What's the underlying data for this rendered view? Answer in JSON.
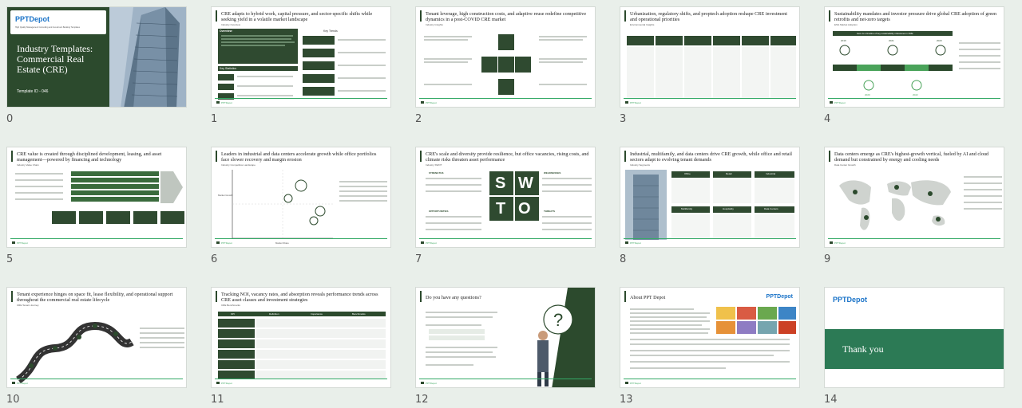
{
  "slides": [
    {
      "index": "0",
      "title": "Industry Templates: Commercial Real Estate (CRE)",
      "subtitle": "Template ID - 046",
      "brand": "PPTDepot",
      "tagline": "High Quality Management Consulting and Investment Banking Templates"
    },
    {
      "index": "1",
      "title": "CRE adapts to hybrid work, capital pressure, and sector-specific shifts while seeking yield in a volatile market landscape",
      "sub": "Industry Overview",
      "h1": "Overview",
      "h2": "Key Statistics",
      "h3": "Key Trends",
      "rows": [
        "Market Size",
        "Growth Rate",
        "Vacancy Rate"
      ],
      "trends": [
        "Hybrid Work Impact",
        "Sustainability Push",
        "Data Center Boom",
        "Retail Resilience",
        "Capital Selectivity"
      ]
    },
    {
      "index": "2",
      "title": "Tenant leverage, high construction costs, and adaptive reuse redefine competitive dynamics in a post-COVID CRE market",
      "sub": "Industry Insights",
      "center": "Industry Rivalry",
      "forces": [
        "Threat of New Entrants",
        "Bargaining Power of Buyers",
        "Bargaining Power of Suppliers",
        "Threat of Substitutes"
      ]
    },
    {
      "index": "3",
      "title": "Urbanization, regulatory shifts, and proptech adoption reshape CRE investment and operational priorities",
      "sub": "Environmental Insights",
      "cols": [
        "Political",
        "Economic",
        "Social",
        "Technological",
        "Legal",
        "Environmental"
      ]
    },
    {
      "index": "4",
      "title": "Sustainability mandates and investor pressure drive global CRE adoption of green retrofits and net-zero targets",
      "sub": "ESG Market Adoption",
      "banner": "Here is a timeline of key sustainability milestones in CRE:",
      "years": [
        "2019",
        "2021",
        "2023",
        "2025",
        "2020",
        "2022",
        "2024"
      ]
    },
    {
      "index": "5",
      "title": "CRE value is created through disciplined development, leasing, and asset management—powered by financing and technology",
      "sub": "Industry Value Chain",
      "bars": [
        "Market Research",
        "Technology Integration",
        "Financing & Legal",
        "Construction Management",
        "Sustainability Consulting"
      ],
      "stages": [
        "Property Development",
        "Acquisition & Investment",
        "Leasing & Sales",
        "Property Management",
        "Disposition / Exit"
      ]
    },
    {
      "index": "6",
      "title": "Leaders in industrial and data centers accelerate growth while office portfolios face slower recovery and margin erosion",
      "sub": "Industry Competitive Landscape",
      "ylabel": "Market Growth",
      "xlabel": "Market Share"
    },
    {
      "index": "7",
      "title": "CRE's scale and diversity provide resilience, but office vacancies, rising costs, and climate risks threaten asset performance",
      "sub": "Industry SWOT",
      "letters": [
        "S",
        "W",
        "T",
        "O"
      ],
      "heads": [
        "STRENGTHS",
        "WEAKNESSES",
        "OPPORTUNITIES",
        "THREATS"
      ]
    },
    {
      "index": "8",
      "title": "Industrial, multifamily, and data centers drive CRE growth, while office and retail sectors adapt to evolving tenant demands",
      "sub": "Industry Segments",
      "segments": [
        "Office",
        "Retail",
        "Industrial",
        "Multifamily",
        "Hospitality",
        "Data Centers"
      ]
    },
    {
      "index": "9",
      "title": "Data centers emerge as CRE's highest-growth vertical, fueled by AI and cloud demand but constrained by energy and cooling needs",
      "sub": "Data Center Growth"
    },
    {
      "index": "10",
      "title": "Tenant experience hinges on space fit, lease flexibility, and operational support throughout the commercial real estate lifecycle",
      "sub": "CRE Tenant Journey",
      "steps": [
        "Need Identification",
        "Property Search",
        "Negotiation & Leasing",
        "Move-In & Setup",
        "Occupancy Management",
        "Exit or Renewal"
      ]
    },
    {
      "index": "11",
      "title": "Tracking NOI, vacancy rates, and absorption reveals performance trends across CRE asset classes and investment strategies",
      "sub": "CRE Benchmarks",
      "heads": [
        "KPI",
        "Definition",
        "Importance",
        "Benchmarks"
      ],
      "kpis": [
        "Net Operating Income (NOI)",
        "Vacancy Rate",
        "Capitalization Rate",
        "Rent Growth Rate",
        "Loan-to-Value Ratio (LTV)",
        "Absorption Rate"
      ]
    },
    {
      "index": "12",
      "title": "Do you have any questions?"
    },
    {
      "index": "13",
      "title": "About PPT Depot",
      "brand": "PPTDepot"
    },
    {
      "index": "14",
      "title": "Thank you",
      "brand": "PPTDepot"
    }
  ],
  "footer": {
    "brand": "PPTDepot",
    "site": "pptdepot.com"
  },
  "colors": {
    "dark_green": "#2c4a2d",
    "accent_green": "#4aa35a",
    "bg": "#e9efea"
  }
}
